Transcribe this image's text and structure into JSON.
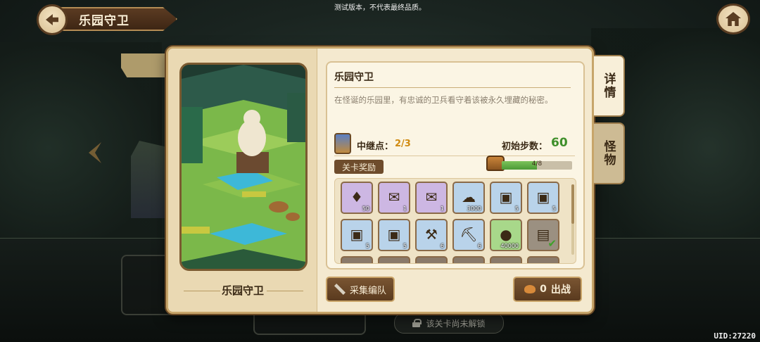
{
  "header": {
    "title": "乐园守卫",
    "watermark": "测试版本，不代表最终品质。",
    "back_icon": "back-arrow-icon",
    "home_icon": "home-icon"
  },
  "background": {
    "locked_text": "该关卡尚未解锁"
  },
  "stage": {
    "name": "乐园守卫",
    "info_title": "乐园守卫",
    "description": "在怪诞的乐园里，有忠诚的卫兵看守着该被永久埋藏的秘密。",
    "relay_label": "中继点：",
    "relay_value": "2/3",
    "steps_label": "初始步数：",
    "steps_value": "60",
    "rewards_label": "关卡奖励",
    "progress_text": "4/8",
    "progress_fraction": 0.5
  },
  "rewards": [
    {
      "count": "50",
      "icon": "gem-icon",
      "bg": "#cdb7e3"
    },
    {
      "count": "1",
      "icon": "scroll-icon",
      "bg": "#cdb7e3"
    },
    {
      "count": "1",
      "icon": "scroll-icon",
      "bg": "#cdb7e3"
    },
    {
      "count": "3000",
      "icon": "ore-icon",
      "bg": "#b9d3ea"
    },
    {
      "count": "5",
      "icon": "crate-icon",
      "bg": "#b9d3ea"
    },
    {
      "count": "5",
      "icon": "crate-icon",
      "bg": "#b9d3ea"
    },
    {
      "count": "5",
      "icon": "crate-icon",
      "bg": "#b9d3ea"
    },
    {
      "count": "5",
      "icon": "crate-icon",
      "bg": "#b9d3ea"
    },
    {
      "count": "6",
      "icon": "hammer-icon",
      "bg": "#b9d3ea"
    },
    {
      "count": "6",
      "icon": "pickaxe-icon",
      "bg": "#b9d3ea"
    },
    {
      "count": "40000",
      "icon": "coin-icon",
      "bg": "#a8d88a"
    },
    {
      "count": "",
      "icon": "map-icon",
      "bg": "#9b9081",
      "claimed": true
    }
  ],
  "buttons": {
    "collect": "采集编队",
    "start_cost": "0",
    "start": "出战"
  },
  "tabs": [
    {
      "label": "详情",
      "active": true
    },
    {
      "label": "怪物",
      "active": false
    }
  ],
  "uid": "UID:27220"
}
